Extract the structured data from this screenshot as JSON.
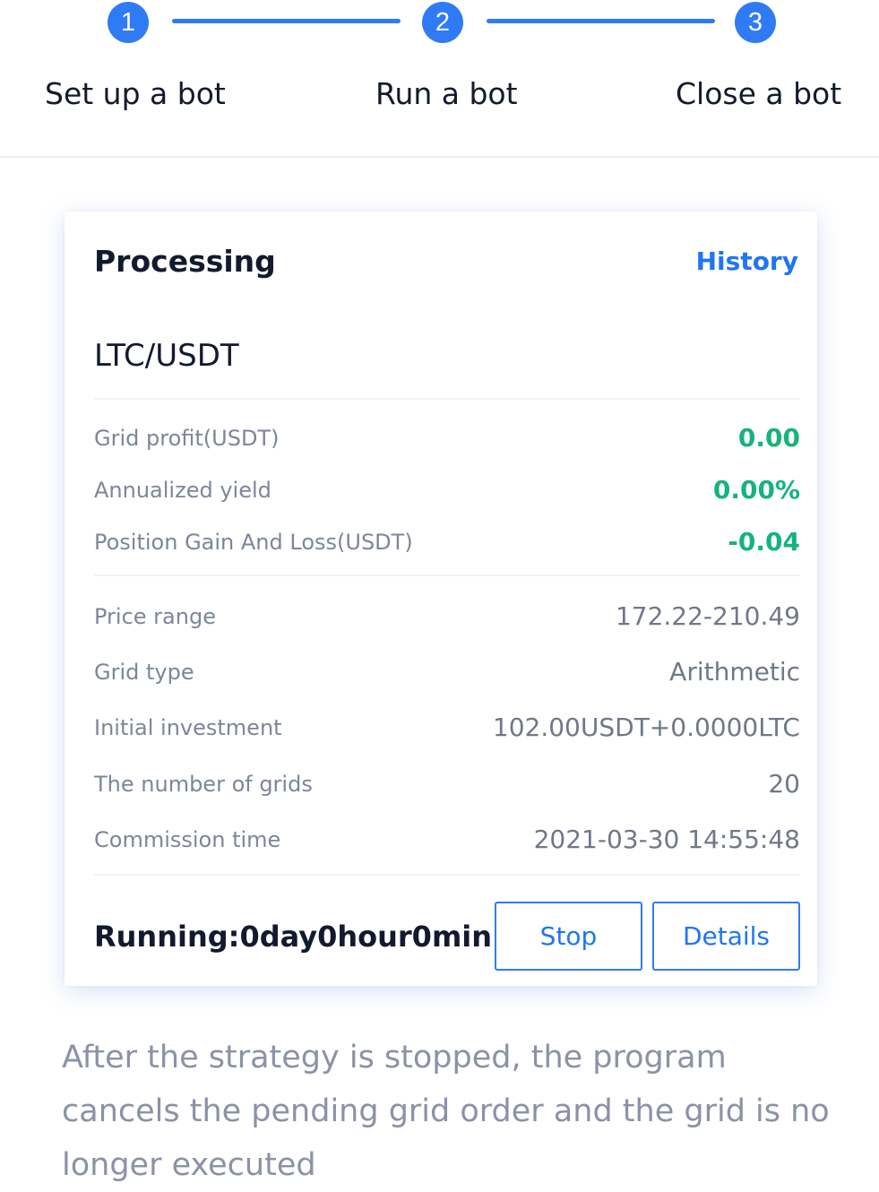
{
  "stepper": {
    "steps": [
      {
        "number": "1",
        "label": "Set up a bot"
      },
      {
        "number": "2",
        "label": "Run a bot"
      },
      {
        "number": "3",
        "label": "Close a bot"
      }
    ]
  },
  "card": {
    "title": "Processing",
    "history_link": "History",
    "pair": "LTC/USDT",
    "profit_rows": [
      {
        "label": "Grid profit(USDT)",
        "value": "0.00"
      },
      {
        "label": "Annualized yield",
        "value": "0.00%"
      },
      {
        "label": "Position Gain And Loss(USDT)",
        "value": "-0.04"
      }
    ],
    "detail_rows": [
      {
        "label": "Price range",
        "value": "172.22-210.49"
      },
      {
        "label": "Grid type",
        "value": "Arithmetic"
      },
      {
        "label": "Initial investment",
        "value": "102.00USDT+0.0000LTC"
      },
      {
        "label": "The number of grids",
        "value": "20"
      },
      {
        "label": "Commission time",
        "value": "2021-03-30 14:55:48"
      }
    ],
    "running_text": "Running:0day0hour0min",
    "stop_label": "Stop",
    "details_label": "Details"
  },
  "description": "After the strategy is stopped, the program cancels the pending grid order and the grid is no longer executed",
  "colors": {
    "accent": "#2f7bf5",
    "positive": "#16b37b",
    "muted_text": "#7c869a"
  }
}
